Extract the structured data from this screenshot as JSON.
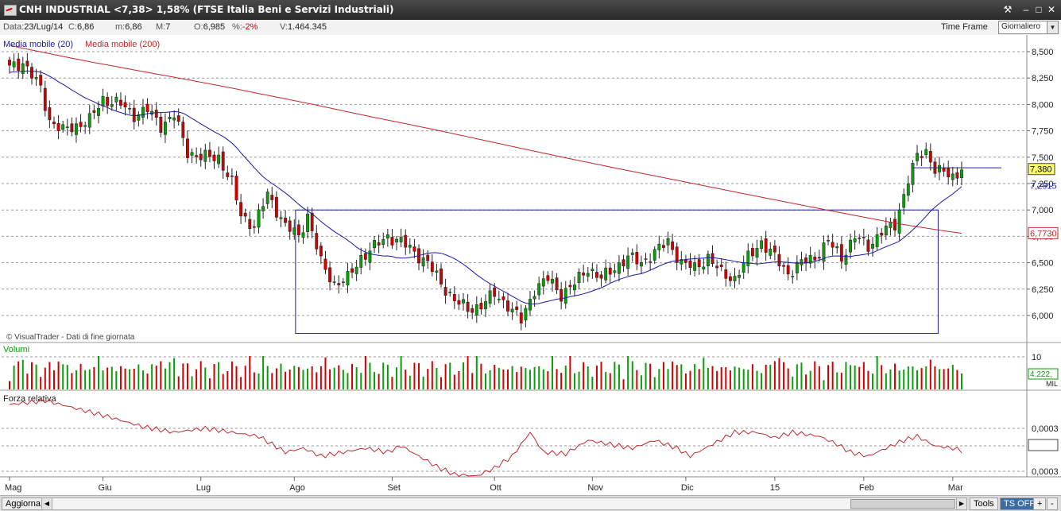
{
  "window": {
    "title": "CNH INDUSTRIAL <7,38> 1,58%  (FTSE Italia Beni e Servizi Industriali)"
  },
  "info": {
    "date_label": "Data:",
    "date_value": "23/Lug/14",
    "close_label": "C:",
    "close_value": "6,86",
    "min_label": "m:",
    "min_value": "6,86",
    "max_label": "M:",
    "max_value": "7",
    "open_label": "O:",
    "open_value": "6,985",
    "pct_label": "%:",
    "pct_value": "-2%",
    "vol_label": "V:",
    "vol_value": "1.464.345",
    "timeframe_label": "Time Frame",
    "timeframe_value": "Giornaliero"
  },
  "bottom": {
    "aggiorna": "Aggiorna",
    "tools": "Tools",
    "ts_off": "TS OFF",
    "plus": "+",
    "minus": "-"
  },
  "colors": {
    "up": "#0a9e0a",
    "down": "#d20000",
    "ma20": "#1a1aa8",
    "ma200": "#c0282d",
    "rs": "#c0282d",
    "grid": "#9a9a9a",
    "rect": "#1a1aa8"
  },
  "chart_data": [
    {
      "type": "candlestick",
      "name": "price",
      "legend": [
        "Media mobile (20)",
        "Media mobile (200)"
      ],
      "y_ticks": [
        "8,500",
        "8,250",
        "8,000",
        "7,750",
        "7,500",
        "7,250",
        "7,000",
        "6,750",
        "6,500",
        "6,250",
        "6,000"
      ],
      "ylim": [
        5.8,
        8.6
      ],
      "x_labels": [
        "Mag",
        "Giu",
        "Lug",
        "Ago",
        "Set",
        "Ott",
        "Nov",
        "Dic",
        "15",
        "Feb",
        "Mar"
      ],
      "x_label_index": [
        0,
        21,
        43,
        64,
        86,
        109,
        131,
        152,
        172,
        192,
        212
      ],
      "watermark": "© VisualTrader - Dati di fine giornata",
      "last_price": "7,380",
      "ma20_last": "7,2915",
      "ma200_last": "6,7730",
      "resistance_level": 7.4,
      "box": {
        "start_index": 65,
        "end_index": 208,
        "price_top": 7.0,
        "price_bottom": 5.83
      },
      "anchors": [
        [
          0,
          8.35
        ],
        [
          3,
          8.4
        ],
        [
          7,
          8.15
        ],
        [
          9,
          7.85
        ],
        [
          12,
          7.75
        ],
        [
          15,
          7.8
        ],
        [
          18,
          7.85
        ],
        [
          21,
          8.05
        ],
        [
          25,
          8.0
        ],
        [
          28,
          7.9
        ],
        [
          31,
          7.95
        ],
        [
          34,
          7.8
        ],
        [
          37,
          7.9
        ],
        [
          40,
          7.55
        ],
        [
          43,
          7.5
        ],
        [
          47,
          7.5
        ],
        [
          50,
          7.25
        ],
        [
          52,
          6.95
        ],
        [
          55,
          6.85
        ],
        [
          58,
          7.15
        ],
        [
          62,
          6.85
        ],
        [
          65,
          6.75
        ],
        [
          67,
          6.95
        ],
        [
          70,
          6.5
        ],
        [
          73,
          6.3
        ],
        [
          76,
          6.35
        ],
        [
          79,
          6.55
        ],
        [
          82,
          6.65
        ],
        [
          85,
          6.75
        ],
        [
          88,
          6.7
        ],
        [
          91,
          6.6
        ],
        [
          94,
          6.5
        ],
        [
          97,
          6.3
        ],
        [
          100,
          6.15
        ],
        [
          103,
          6.05
        ],
        [
          106,
          6.1
        ],
        [
          109,
          6.2
        ],
        [
          112,
          6.1
        ],
        [
          115,
          5.95
        ],
        [
          118,
          6.25
        ],
        [
          121,
          6.35
        ],
        [
          124,
          6.2
        ],
        [
          127,
          6.3
        ],
        [
          130,
          6.45
        ],
        [
          133,
          6.35
        ],
        [
          136,
          6.45
        ],
        [
          139,
          6.55
        ],
        [
          142,
          6.5
        ],
        [
          145,
          6.6
        ],
        [
          148,
          6.7
        ],
        [
          151,
          6.5
        ],
        [
          154,
          6.45
        ],
        [
          157,
          6.55
        ],
        [
          160,
          6.4
        ],
        [
          163,
          6.35
        ],
        [
          166,
          6.55
        ],
        [
          169,
          6.7
        ],
        [
          172,
          6.55
        ],
        [
          175,
          6.4
        ],
        [
          178,
          6.5
        ],
        [
          181,
          6.55
        ],
        [
          184,
          6.7
        ],
        [
          187,
          6.55
        ],
        [
          190,
          6.75
        ],
        [
          193,
          6.65
        ],
        [
          196,
          6.8
        ],
        [
          199,
          6.85
        ],
        [
          202,
          7.3
        ],
        [
          204,
          7.5
        ],
        [
          206,
          7.55
        ],
        [
          208,
          7.4
        ],
        [
          210,
          7.35
        ],
        [
          212,
          7.3
        ],
        [
          214,
          7.38
        ]
      ],
      "volume_tick": "10",
      "volume_last": "4.222,",
      "volume_unit": "MIL",
      "volume_title": "Volumi",
      "rs_title": "Forza relativa",
      "rs_ticks": [
        "0,0003",
        "0,0003",
        "0,0003"
      ],
      "rs_anchors": [
        [
          0,
          0.9
        ],
        [
          8,
          0.95
        ],
        [
          15,
          0.85
        ],
        [
          22,
          0.75
        ],
        [
          30,
          0.62
        ],
        [
          37,
          0.55
        ],
        [
          44,
          0.6
        ],
        [
          50,
          0.55
        ],
        [
          56,
          0.5
        ],
        [
          62,
          0.3
        ],
        [
          66,
          0.35
        ],
        [
          70,
          0.25
        ],
        [
          75,
          0.3
        ],
        [
          80,
          0.35
        ],
        [
          85,
          0.3
        ],
        [
          88,
          0.38
        ],
        [
          92,
          0.25
        ],
        [
          96,
          0.12
        ],
        [
          100,
          0.02
        ],
        [
          105,
          0.0
        ],
        [
          109,
          0.1
        ],
        [
          113,
          0.25
        ],
        [
          117,
          0.55
        ],
        [
          120,
          0.3
        ],
        [
          125,
          0.28
        ],
        [
          130,
          0.45
        ],
        [
          135,
          0.4
        ],
        [
          140,
          0.35
        ],
        [
          145,
          0.45
        ],
        [
          150,
          0.35
        ],
        [
          153,
          0.25
        ],
        [
          158,
          0.4
        ],
        [
          163,
          0.55
        ],
        [
          168,
          0.55
        ],
        [
          172,
          0.48
        ],
        [
          176,
          0.55
        ],
        [
          182,
          0.5
        ],
        [
          186,
          0.4
        ],
        [
          189,
          0.3
        ],
        [
          193,
          0.25
        ],
        [
          197,
          0.35
        ],
        [
          201,
          0.45
        ],
        [
          204,
          0.5
        ],
        [
          208,
          0.38
        ],
        [
          212,
          0.35
        ],
        [
          214,
          0.32
        ]
      ]
    }
  ]
}
